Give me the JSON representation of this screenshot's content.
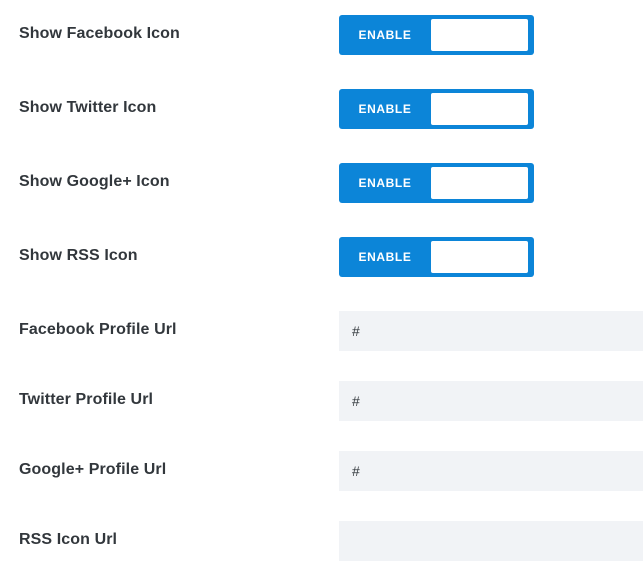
{
  "toggles": [
    {
      "label": "Show Facebook Icon",
      "state_label": "ENABLE"
    },
    {
      "label": "Show Twitter Icon",
      "state_label": "ENABLE"
    },
    {
      "label": "Show Google+ Icon",
      "state_label": "ENABLE"
    },
    {
      "label": "Show RSS Icon",
      "state_label": "ENABLE"
    }
  ],
  "url_fields": [
    {
      "label": "Facebook Profile Url",
      "value": "#"
    },
    {
      "label": "Twitter Profile Url",
      "value": "#"
    },
    {
      "label": "Google+ Profile Url",
      "value": "#"
    },
    {
      "label": "RSS Icon Url",
      "value": ""
    }
  ],
  "colors": {
    "toggle_active": "#0c85d8",
    "field_background": "#f1f3f6",
    "label_text": "#32373c"
  }
}
